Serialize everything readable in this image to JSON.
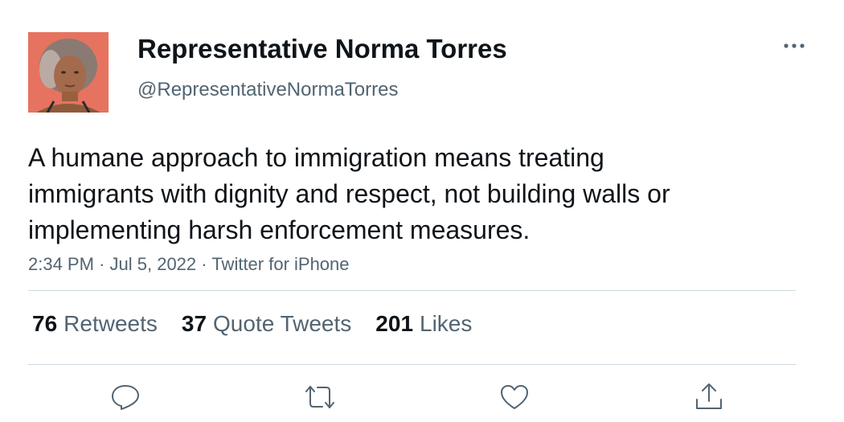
{
  "author": {
    "name": "Representative Norma Torres",
    "handle": "@RepresentativeNormaTorres"
  },
  "tweet": {
    "text": "A humane approach to immigration means treating immigrants with dignity and respect, not building walls or implementing harsh enforcement measures.",
    "time": "2:34 PM",
    "date": "Jul 5, 2022",
    "source": "Twitter for iPhone",
    "separator": "·"
  },
  "stats": {
    "retweets": {
      "count": "76",
      "label": "Retweets"
    },
    "quote_tweets": {
      "count": "37",
      "label": "Quote Tweets"
    },
    "likes": {
      "count": "201",
      "label": "Likes"
    }
  },
  "actions": [
    "reply-icon",
    "retweet-icon",
    "like-icon",
    "share-icon"
  ],
  "colors": {
    "text": "#0f1419",
    "secondary": "#536471",
    "divider": "#cfd9de",
    "avatar_background": "#e6735f"
  }
}
